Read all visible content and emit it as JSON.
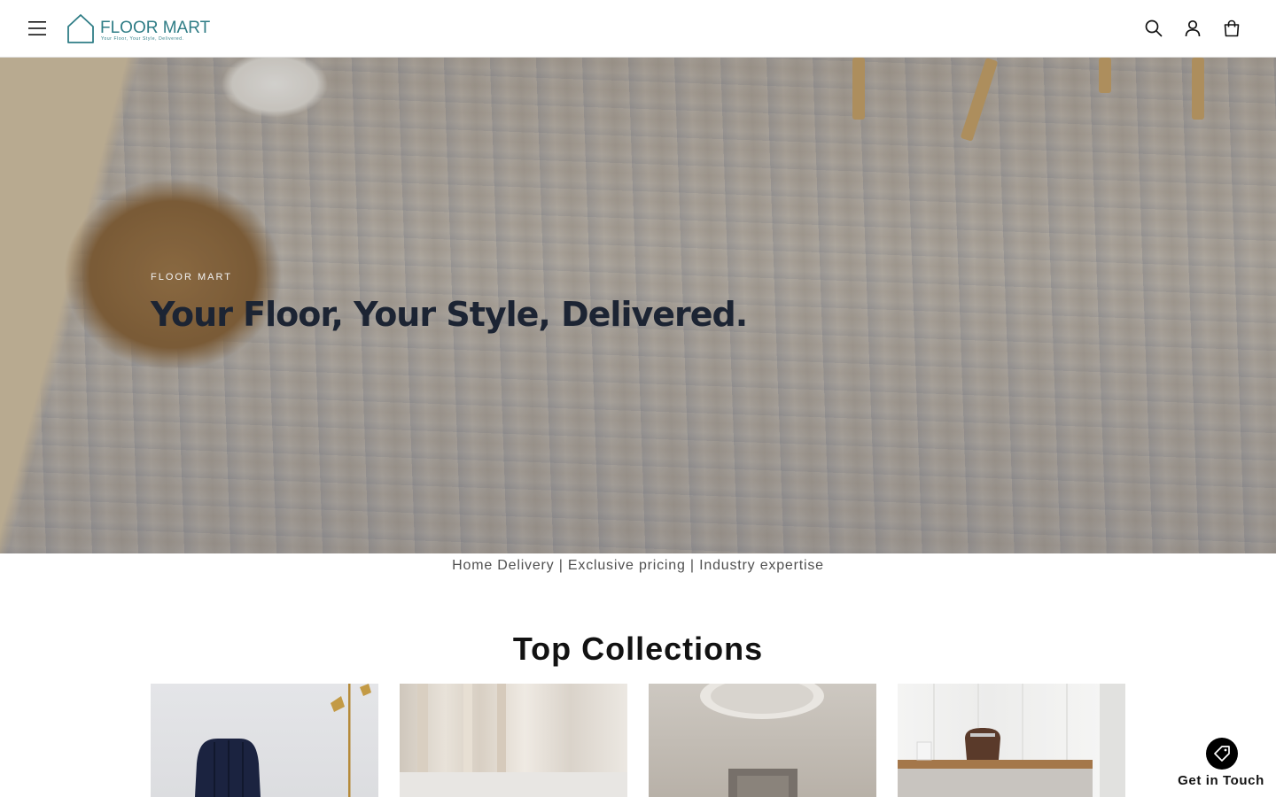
{
  "header": {
    "logo_name": "FLOOR MART",
    "logo_tagline": "Your Floor, Your Style, Delivered.",
    "brand_color": "#2f7d86",
    "icons": [
      "menu-icon",
      "search-icon",
      "account-icon",
      "cart-icon"
    ]
  },
  "hero": {
    "kicker": "FLOOR MART",
    "title": "Your Floor, Your Style, Delivered."
  },
  "features": {
    "text": "Home Delivery | Exclusive pricing | Industry expertise"
  },
  "collections": {
    "title": "Top Collections"
  },
  "contact": {
    "label": "Get in Touch",
    "icon": "tag-icon"
  }
}
